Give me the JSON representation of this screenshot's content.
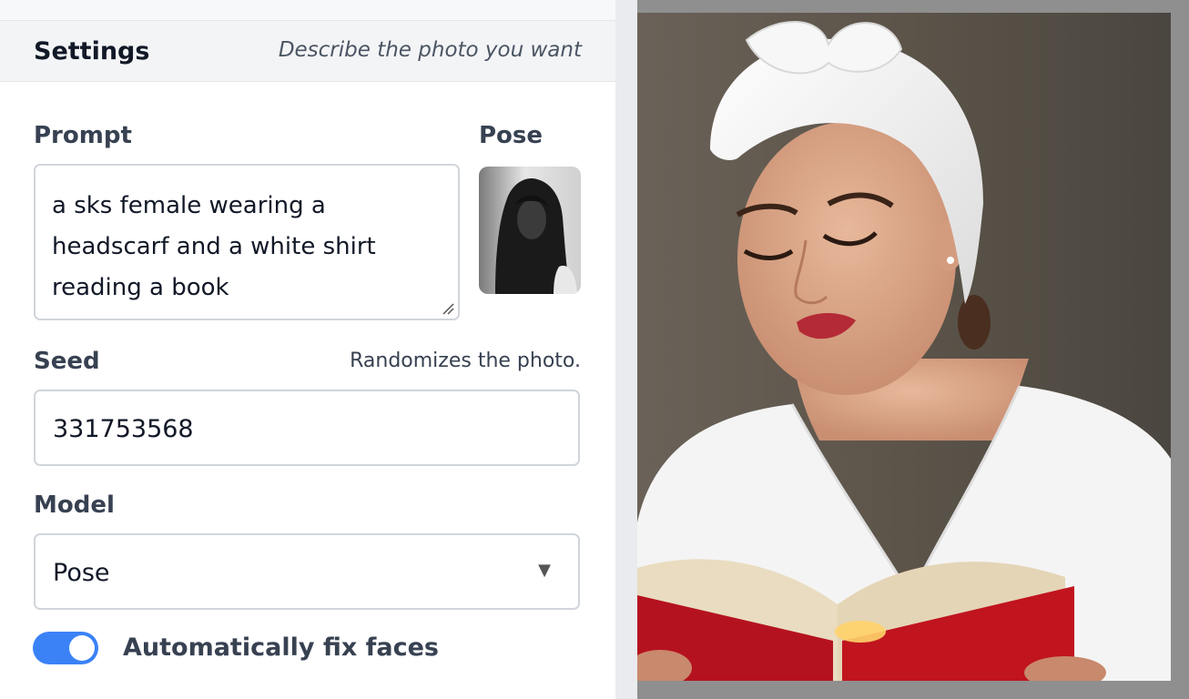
{
  "settings": {
    "title": "Settings",
    "subtitle": "Describe the photo you want"
  },
  "prompt": {
    "label": "Prompt",
    "value": "a sks female wearing a\nheadscarf and a white shirt\nreading a book"
  },
  "pose": {
    "label": "Pose"
  },
  "seed": {
    "label": "Seed",
    "hint": "Randomizes the photo.",
    "value": "331753568"
  },
  "model": {
    "label": "Model",
    "selected": "Pose"
  },
  "fix_faces": {
    "label": "Automatically fix faces",
    "enabled": true
  },
  "colors": {
    "accent": "#3b82f6",
    "border": "#d1d5db",
    "header_bg": "#f3f4f6"
  }
}
